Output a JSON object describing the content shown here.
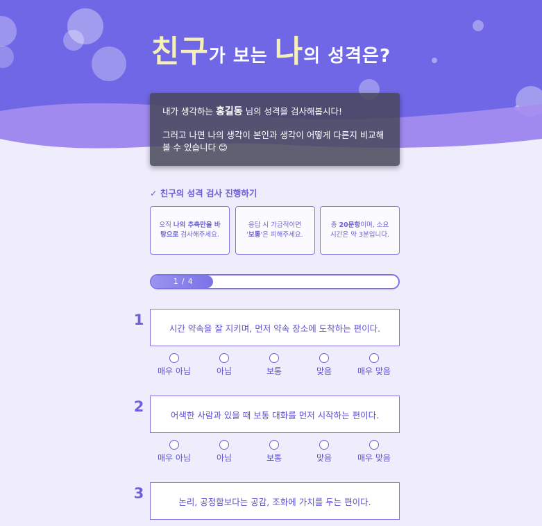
{
  "title": {
    "part1": "친구",
    "part2": "가 보는 ",
    "part3": "나",
    "part4": "의 성격은?"
  },
  "notice": {
    "line1_pre": "내가 생각하는 ",
    "name": "홍길동",
    "line1_post": " 님의 성격을 검사해봅시다!",
    "line2": "그러고 나면 나의 생각이 본인과 생각이 어떻게 다른지 비교해볼 수 있습니다 😊"
  },
  "section_heading": "✓ 친구의 성격 검사 진행하기",
  "info_cards": [
    {
      "pre": "오직 ",
      "bold": "나의 추측만을 바탕으로",
      "post": " 검사해주세요."
    },
    {
      "pre": "응답 시 가급적이면 '",
      "bold": "보통",
      "post": "'은 피해주세요."
    },
    {
      "pre": "총 ",
      "bold": "20문항",
      "post": "이며, 소요 시간은 약 3분입니다."
    }
  ],
  "progress": {
    "label": "1 / 4",
    "fraction": 0.25
  },
  "questions": [
    {
      "number": "1",
      "text": "시간 약속을 잘 지키며, 먼저 약속 장소에 도착하는 편이다."
    },
    {
      "number": "2",
      "text": "어색한 사람과 있을 때 보통 대화를 먼저 시작하는 편이다."
    },
    {
      "number": "3",
      "text": "논리, 공정함보다는 공감, 조화에 가치를 두는 편이다."
    }
  ],
  "options": [
    "매우 아님",
    "아님",
    "보통",
    "맞음",
    "매우 맞음"
  ],
  "colors": {
    "accent": "#6b61d8",
    "hero": "#7067e6",
    "background": "#efedfc",
    "title_highlight": "#f4f0b8"
  }
}
